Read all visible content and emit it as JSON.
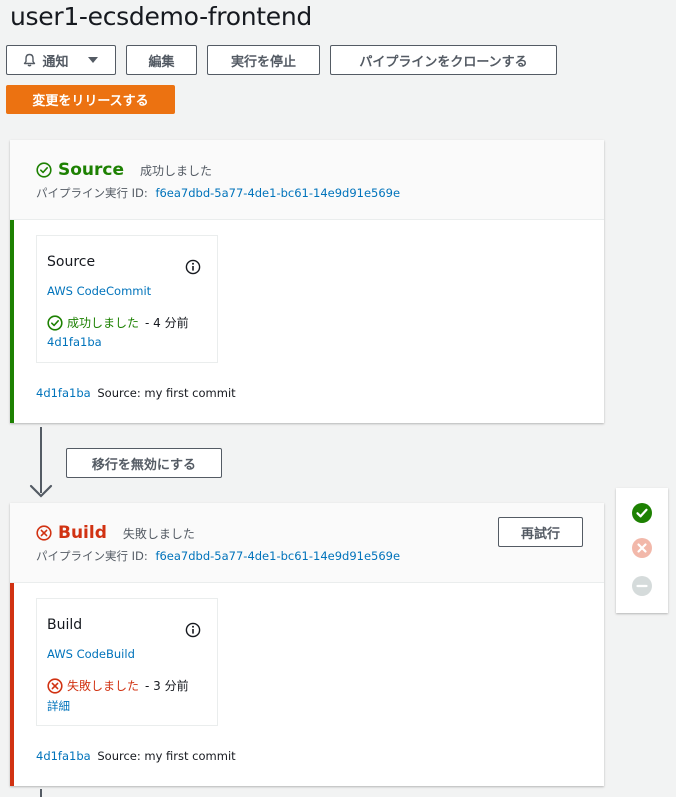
{
  "page": {
    "title": "user1-ecsdemo-frontend"
  },
  "toolbar": {
    "notify_label": "通知",
    "edit_label": "編集",
    "stop_label": "実行を停止",
    "clone_label": "パイプラインをクローンする",
    "release_label": "変更をリリースする"
  },
  "stages": {
    "source": {
      "name": "Source",
      "status": "成功しました",
      "exec_label": "パイプライン実行 ID:",
      "exec_id": "f6ea7dbd-5a77-4de1-bc61-14e9d91e569e",
      "action": {
        "name": "Source",
        "provider": "AWS CodeCommit",
        "status": "成功しました",
        "time": "- 4 分前",
        "sub_link": "4d1fa1ba"
      },
      "commit_id": "4d1fa1ba",
      "commit_msg": "Source: my first commit"
    },
    "transition": {
      "disable_label": "移行を無効にする"
    },
    "build": {
      "name": "Build",
      "status": "失敗しました",
      "exec_label": "パイプライン実行 ID:",
      "exec_id": "f6ea7dbd-5a77-4de1-bc61-14e9d91e569e",
      "retry_label": "再試行",
      "action": {
        "name": "Build",
        "provider": "AWS CodeBuild",
        "status": "失敗しました",
        "time": "- 3 分前",
        "sub_link": "詳細"
      },
      "commit_id": "4d1fa1ba",
      "commit_msg": "Source: my first commit"
    }
  },
  "colors": {
    "success": "#1d8102",
    "error": "#d13212",
    "link": "#0073bb",
    "primary": "#ec7211"
  },
  "icons": {
    "notify": "bell-icon",
    "dropdown": "caret-down-icon",
    "success": "check-circle-icon",
    "error": "x-circle-icon",
    "info": "info-icon",
    "legend_success": "check-filled-icon",
    "legend_error": "x-filled-icon",
    "legend_disabled": "minus-filled-icon"
  }
}
